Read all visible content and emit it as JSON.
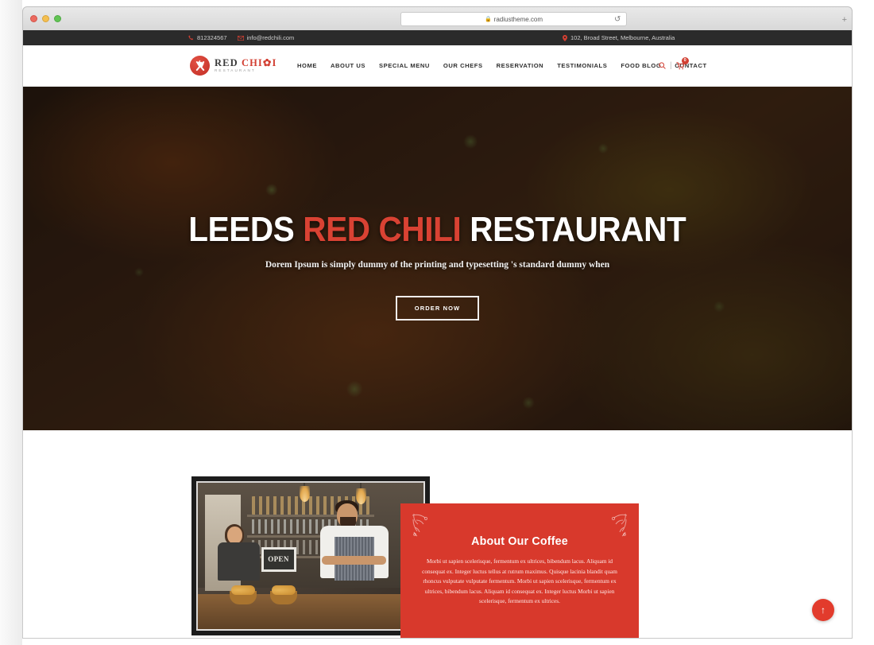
{
  "browser": {
    "url": "radiustheme.com",
    "lock_icon": "lock-icon",
    "reload_icon": "reload-icon",
    "new_tab_label": "+"
  },
  "topbar": {
    "phone": "812324567",
    "email": "info@redchili.com",
    "address": "102, Broad Street, Melbourne, Australia",
    "phone_icon": "phone-icon",
    "email_icon": "envelope-icon",
    "location_icon": "map-pin-icon"
  },
  "logo": {
    "word1": "RED",
    "word2": "CHI",
    "word3": "I",
    "pepper_icon": "chili-pepper-icon",
    "tagline": "RESTAURANT"
  },
  "nav": {
    "items": [
      {
        "label": "HOME",
        "active": true
      },
      {
        "label": "ABOUT US",
        "active": false
      },
      {
        "label": "SPECIAL MENU",
        "active": false
      },
      {
        "label": "OUR CHEFS",
        "active": false
      },
      {
        "label": "RESERVATION",
        "active": false
      },
      {
        "label": "TESTIMONIALS",
        "active": false
      },
      {
        "label": "FOOD BLOG",
        "active": false
      },
      {
        "label": "CONTACT",
        "active": false
      }
    ]
  },
  "header_actions": {
    "search_icon": "search-icon",
    "divider": "|",
    "cart_icon": "shopping-cart-icon",
    "cart_count": "0"
  },
  "hero": {
    "title_part1": "LEEDS ",
    "title_accent": "RED CHILI",
    "title_part2": " RESTAURANT",
    "subtitle": "Dorem Ipsum is simply dummy of the printing and typesetting 's standard dummy when",
    "button_label": "ORDER NOW"
  },
  "about": {
    "image_sign_text": "OPEN",
    "title": "About Our Coffee",
    "paragraph": "Morbi ut sapien scelerisque, fermentum ex ultrices, bibendum lacus. Aliquam id consequat ex. Integer luctus tellus at rutrum maximus. Quisque lacinia blandit quam rhoncus vulputate vulputate fermentum. Morbi ut sapien scelerisque, fermentum ex ultrices, bibendum lacus. Aliquam id consequat ex. Integer luctus Morbi ut sapien scelerisque, fermentum ex ultrices."
  },
  "scroll_top": {
    "icon": "arrow-up-icon"
  },
  "colors": {
    "brand_red": "#d8392c",
    "accent_red": "#d94233",
    "topbar_bg": "#2b2b2b",
    "header_bg": "#ffffff",
    "scroll_top_bg": "#e23b2c"
  }
}
